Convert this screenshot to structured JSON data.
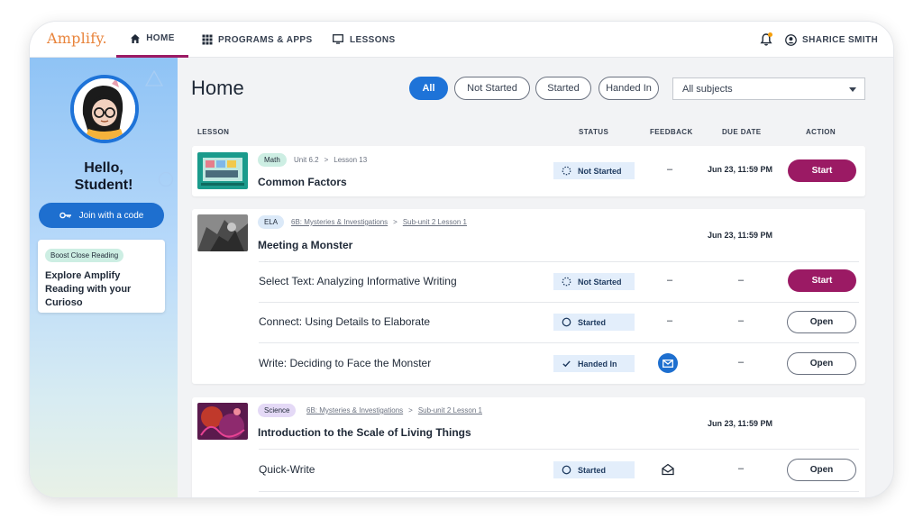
{
  "nav": {
    "logo": "Amplify.",
    "home": "HOME",
    "programs": "PROGRAMS & APPS",
    "lessons": "LESSONS",
    "user_name": "SHARICE SMITH"
  },
  "sidebar": {
    "greeting": "Hello,\nStudent!",
    "join_label": "Join with a code",
    "promo_tag": "Boost Close Reading",
    "promo_text": "Explore Amplify Reading with your Curioso"
  },
  "main": {
    "title": "Home",
    "filters": [
      "All",
      "Not Started",
      "Started",
      "Handed In"
    ],
    "subject_select": "All subjects",
    "columns": {
      "lesson": "LESSON",
      "status": "STATUS",
      "feedback": "FEEDBACK",
      "due": "DUE DATE",
      "action": "ACTION"
    }
  },
  "cards": [
    {
      "subject": "Math",
      "breadcrumb": [
        "Unit 6.2",
        ">",
        "Lesson 13"
      ],
      "title": "Common Factors",
      "status": "Not Started",
      "feedback": "–",
      "due": "Jun 23, 11:59 PM",
      "action": "Start"
    },
    {
      "subject": "ELA",
      "breadcrumb": [
        "6B: Mysteries & Investigations",
        ">",
        "Sub-unit 2 Lesson 1"
      ],
      "title": "Meeting a Monster",
      "due": "Jun 23, 11:59 PM",
      "activities": [
        {
          "name": "Select Text: Analyzing Informative Writing",
          "status": "Not Started",
          "feedback": "–",
          "due": "–",
          "action": "Start"
        },
        {
          "name": "Connect: Using Details to Elaborate",
          "status": "Started",
          "feedback": "–",
          "due": "–",
          "action": "Open"
        },
        {
          "name": "Write: Deciding to Face the Monster",
          "status": "Handed In",
          "feedback": "mail-icon",
          "due": "–",
          "action": "Open"
        }
      ]
    },
    {
      "subject": "Science",
      "breadcrumb": [
        "6B: Mysteries & Investigations",
        ">",
        "Sub-unit 2 Lesson 1"
      ],
      "title": "Introduction to the Scale of Living Things",
      "due": "Jun 23, 11:59 PM",
      "activities": [
        {
          "name": "Quick-Write",
          "status": "Started",
          "feedback": "mail-open-icon",
          "due": "–",
          "action": "Open"
        }
      ]
    }
  ],
  "colors": {
    "accent": "#9b1a64",
    "primary": "#1e73d8",
    "logo": "#e8833a",
    "status_bg": "#e3eefb",
    "tag_math": "#cdeee3",
    "tag_ela": "#dbe9f8",
    "tag_science": "#e4d9f6"
  }
}
